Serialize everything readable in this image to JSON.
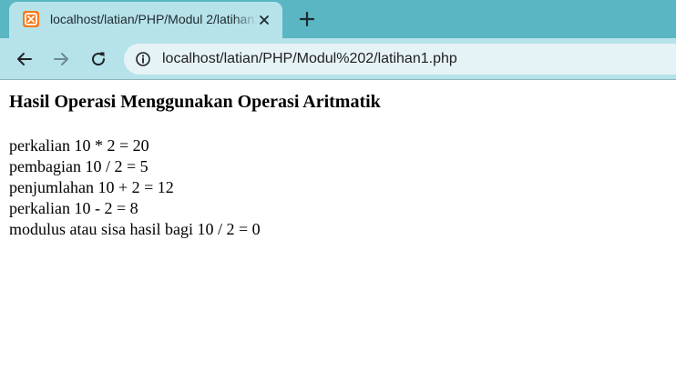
{
  "browser": {
    "tab": {
      "title": "localhost/latian/PHP/Modul 2/latihan1.php",
      "favicon": "xampp-icon"
    },
    "new_tab_icon": "plus-icon",
    "toolbar": {
      "back_icon": "arrow-left-icon",
      "forward_icon": "arrow-right-icon",
      "reload_icon": "reload-icon",
      "info_icon": "info-icon",
      "url": "localhost/latian/PHP/Modul%202/latihan1.php"
    },
    "colors": {
      "tabstrip": "#5ab6c3",
      "toolbar": "#b6e2ea",
      "omnibox": "#e6f3f6",
      "favicon": "#f8791c"
    }
  },
  "page": {
    "heading": "Hasil Operasi Menggunakan Operasi Aritmatik",
    "results": [
      "perkalian 10 * 2 = 20",
      "pembagian 10 / 2 = 5",
      "penjumlahan 10 + 2 = 12",
      "perkalian 10 - 2 = 8",
      "modulus atau sisa hasil bagi 10 / 2 = 0"
    ]
  }
}
